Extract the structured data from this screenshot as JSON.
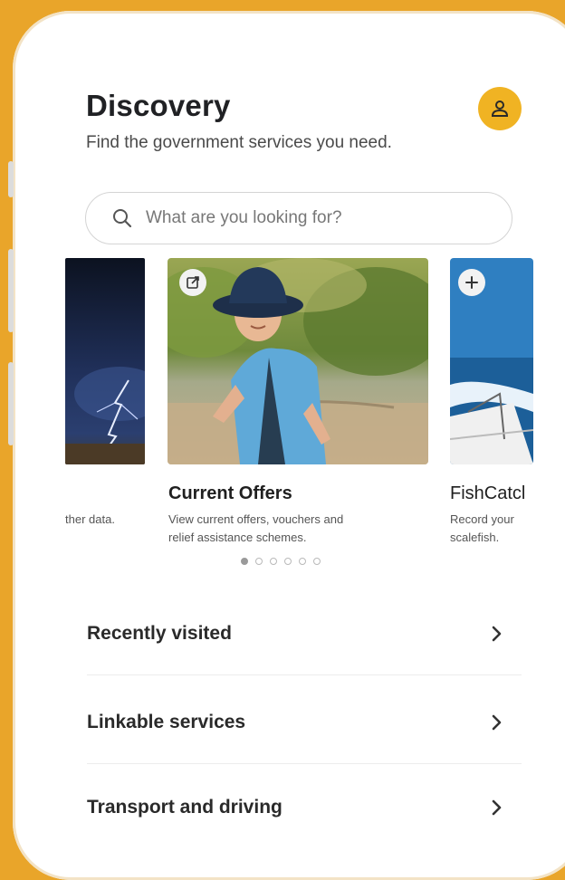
{
  "header": {
    "title": "Discovery",
    "subtitle": "Find the government services you need."
  },
  "profile": {
    "icon": "user-icon",
    "color": "#f0b323"
  },
  "search": {
    "placeholder": "What are you looking for?",
    "icon": "search-icon"
  },
  "carousel": {
    "cards": [
      {
        "title": "",
        "desc_lines": [
          "ther data.",
          ""
        ],
        "image": "lightning-storm",
        "badge": ""
      },
      {
        "title": "Current Offers",
        "desc_lines": [
          "View current offers, vouchers and",
          "relief assistance schemes."
        ],
        "image": "boy-in-hat",
        "badge": "external-link-icon"
      },
      {
        "title": "FishCatcl",
        "desc_lines": [
          "Record your",
          "scalefish."
        ],
        "image": "boat-on-sea",
        "badge": "plus-icon"
      }
    ],
    "page_count": 6,
    "active_page": 1
  },
  "sections": [
    {
      "label": "Recently visited",
      "icon": "chevron-right-icon"
    },
    {
      "label": "Linkable services",
      "icon": "chevron-right-icon"
    },
    {
      "label": "Transport and driving",
      "icon": "chevron-right-icon"
    }
  ],
  "colors": {
    "background": "#e9a52a",
    "accent": "#f0b323",
    "text": "#202124"
  }
}
